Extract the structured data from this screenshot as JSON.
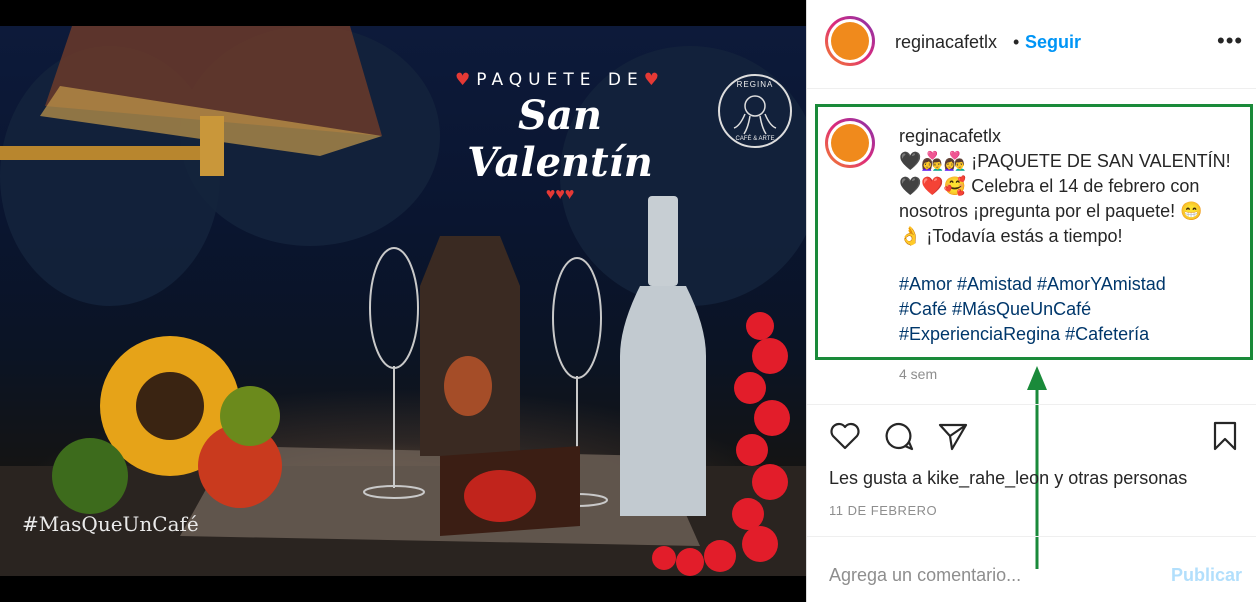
{
  "photo": {
    "headline_small": "PAQUETE DE",
    "headline_big": "San Valentín",
    "logo_top": "REGINA",
    "logo_bottom": "CAFÉ & ARTE",
    "watermark": "#MasQueUnCafé"
  },
  "header": {
    "username": "reginacafetlx",
    "separator": "•",
    "follow_label": "Seguir",
    "more_label": "•••"
  },
  "caption": {
    "username": "reginacafetlx",
    "lines": [
      "🖤👩‍❤️‍👨👩‍❤️‍👨 ¡PAQUETE DE SAN VALENTÍN!",
      "🖤❤️🥰 Celebra el 14 de febrero con",
      "nosotros ¡pregunta por el paquete! 😁",
      "👌 ¡Todavía estás a tiempo!"
    ],
    "hashtags": [
      "#Amor #Amistad #AmorYAmistad",
      "#Café #MásQueUnCafé",
      "#ExperienciaRegina #Cafetería"
    ],
    "time": "4 sem"
  },
  "engagement": {
    "likes_prefix": "Les gusta a",
    "likes_user": "kike_rahe_leon",
    "likes_mid": "y",
    "likes_suffix": "otras personas",
    "date": "11 DE FEBRERO"
  },
  "comment_box": {
    "placeholder": "Agrega un comentario...",
    "publish_label": "Publicar"
  },
  "colors": {
    "link_blue": "#0095f6",
    "hashtag_blue": "#00376b",
    "highlight_green": "#1a8a3a",
    "muted_gray": "#8e8e8e"
  }
}
